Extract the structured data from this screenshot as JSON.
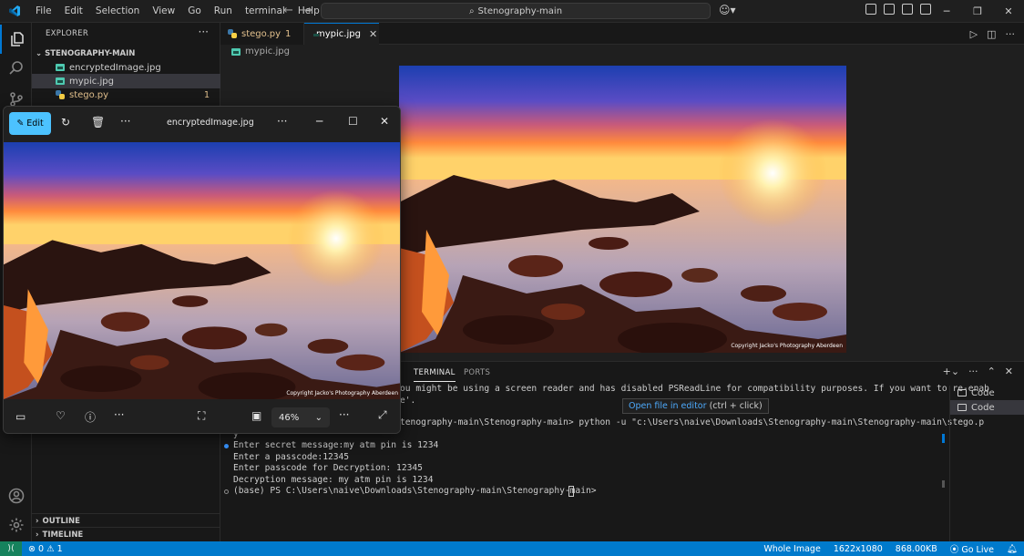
{
  "titlebar": {
    "menu": [
      "File",
      "Edit",
      "Selection",
      "View",
      "Go",
      "Run",
      "terminal",
      "Help"
    ],
    "search_text": "Stenography-main"
  },
  "sidebar": {
    "title": "EXPLORER",
    "folder": "STENOGRAPHY-MAIN",
    "files": [
      {
        "name": "encryptedImage.jpg",
        "type": "image"
      },
      {
        "name": "mypic.jpg",
        "type": "image",
        "selected": true
      },
      {
        "name": "stego.py",
        "type": "python",
        "badge": "1"
      }
    ],
    "sections": [
      "OUTLINE",
      "TIMELINE"
    ]
  },
  "tabs": [
    {
      "label": "stego.py",
      "badge": "1",
      "active": false
    },
    {
      "label": "mypic.jpg",
      "active": true
    }
  ],
  "breadcrumb": "mypic.jpg",
  "image_watermark": "Copyright Jacko's Photography Aberdeen",
  "panel": {
    "tabs": [
      "TERMINAL",
      "PORTS"
    ],
    "lines": [
      "ou might be using a screen reader and has disabled PSReadLine for compatibility purposes. If you want to re-enab",
      "e'.",
      "tenography-main\\Stenography-main> python -u \"c:\\Users\\naive\\Downloads\\Stenography-main\\Stenography-main\\stego.p",
      "y",
      "Enter secret message:my atm pin is 1234",
      "Enter a passcode:12345",
      "Enter passcode for Decryption: 12345",
      "Decryption message: my atm pin is 1234",
      "(base) PS C:\\Users\\naive\\Downloads\\Stenography-main\\Stenography-main> "
    ],
    "terminals": [
      "Code",
      "Code"
    ],
    "tooltip_link": "Open file in editor",
    "tooltip_hint": "(ctrl + click)"
  },
  "statusbar": {
    "errors": "0",
    "warnings": "1",
    "view": "Whole Image",
    "dimensions": "1622x1080",
    "size": "868.00KB",
    "golive": "Go Live"
  },
  "photos": {
    "edit_label": "Edit",
    "title": "encryptedImage.jpg",
    "zoom": "46%",
    "watermark": "Copyright Jacko's Photography Aberdeen"
  },
  "colors": {
    "accent": "#0078d4",
    "statusbar": "#007acc",
    "photos_edit": "#4cc2ff"
  }
}
